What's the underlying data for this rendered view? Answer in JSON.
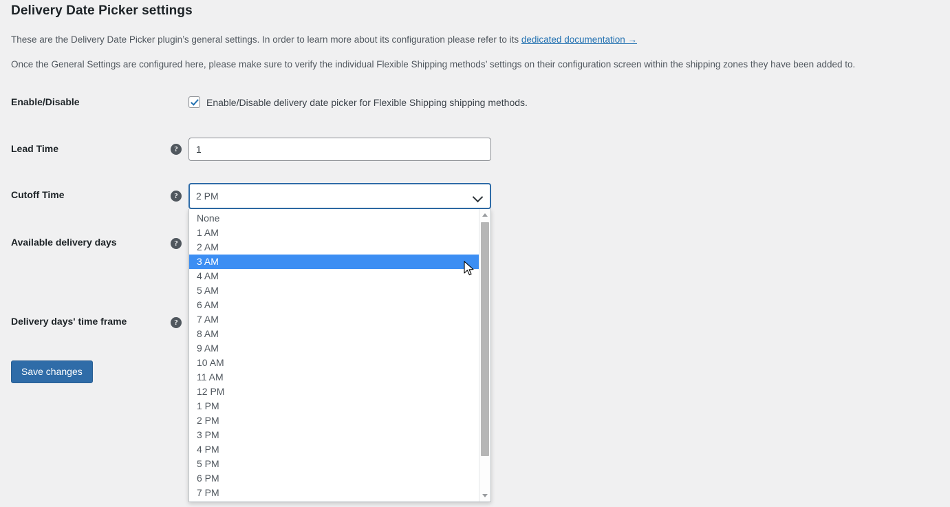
{
  "page": {
    "title": "Delivery Date Picker settings",
    "description_1_prefix": "These are the Delivery Date Picker plugin’s general settings. In order to learn more about its configuration please refer to its ",
    "description_1_link": "dedicated documentation →",
    "description_2": "Once the General Settings are configured here, please make sure to verify the individual Flexible Shipping methods’ settings on their configuration screen within the shipping zones they have been added to."
  },
  "colors": {
    "background": "#f0f0f1",
    "accent": "#2271b1",
    "button": "#2f6ca8",
    "highlight": "#3c8ef3",
    "text": "#3c434a",
    "heading": "#1d2327"
  },
  "fields": {
    "enable_disable": {
      "label": "Enable/Disable",
      "checkbox_label": "Enable/Disable delivery date picker for Flexible Shipping shipping methods.",
      "checked": true
    },
    "lead_time": {
      "label": "Lead Time",
      "value": "1",
      "help_icon": "question-mark-icon"
    },
    "cutoff_time": {
      "label": "Cutoff Time",
      "value": "2 PM",
      "help_icon": "question-mark-icon",
      "expanded": true,
      "highlighted_option": "3 AM",
      "options": [
        "None",
        "1 AM",
        "2 AM",
        "3 AM",
        "4 AM",
        "5 AM",
        "6 AM",
        "7 AM",
        "8 AM",
        "9 AM",
        "10 AM",
        "11 AM",
        "12 PM",
        "1 PM",
        "2 PM",
        "3 PM",
        "4 PM",
        "5 PM",
        "6 PM",
        "7 PM"
      ]
    },
    "available_delivery_days": {
      "label": "Available delivery days",
      "help_icon": "question-mark-icon"
    },
    "delivery_days_time_frame": {
      "label": "Delivery days' time frame",
      "help_icon": "question-mark-icon"
    }
  },
  "actions": {
    "save_label": "Save changes"
  },
  "icons": {
    "help": "?",
    "chevron_down": "chevron-down-icon",
    "scroll_up": "scroll-up-arrow-icon",
    "scroll_down": "scroll-down-arrow-icon",
    "cursor": "mouse-pointer-icon"
  }
}
